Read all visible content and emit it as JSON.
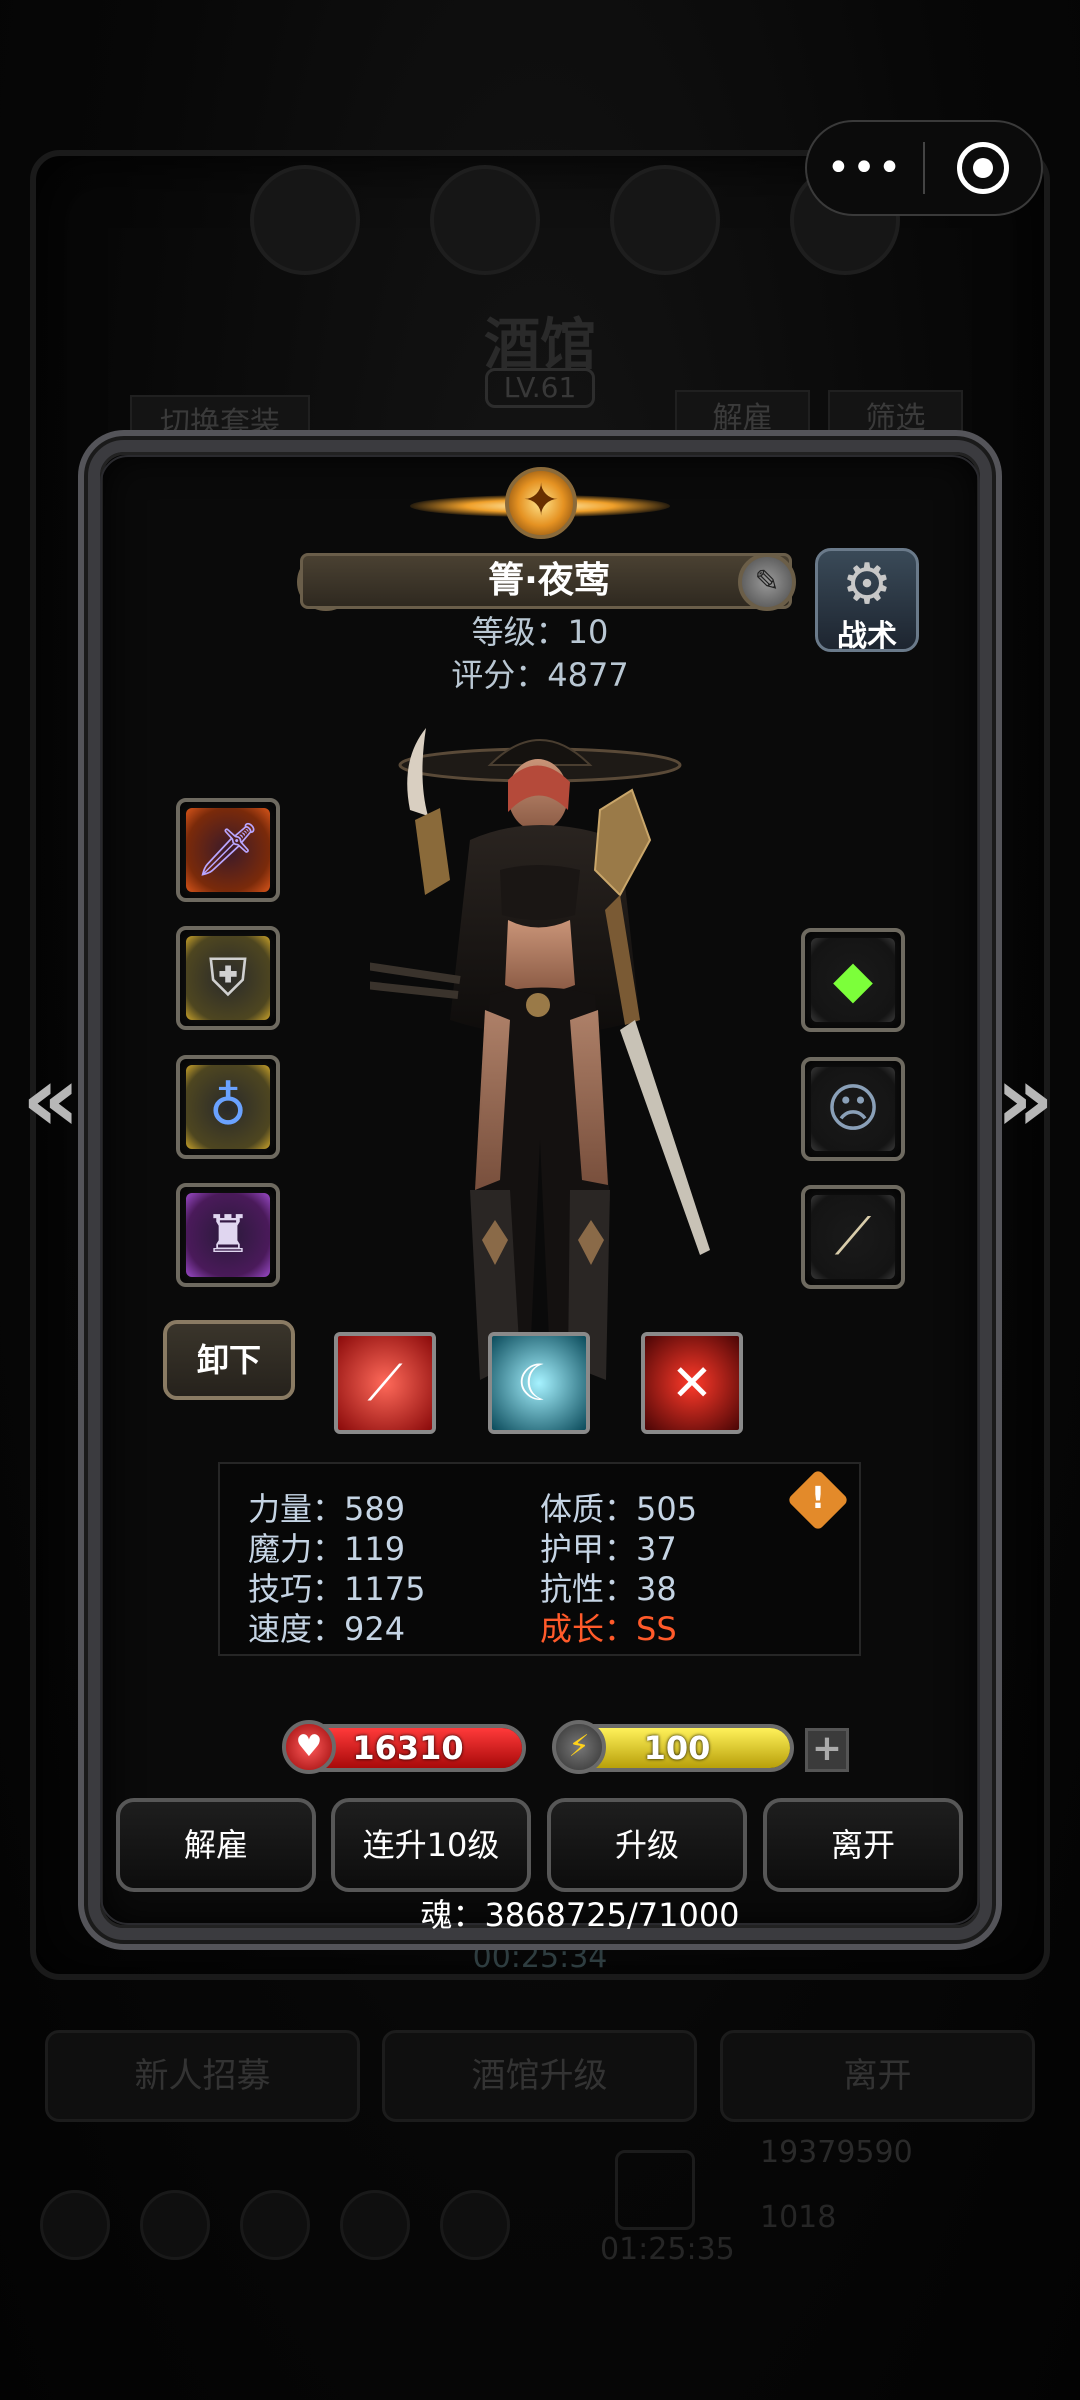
{
  "background": {
    "title": "酒馆",
    "level": "LV.61",
    "switch_outfit_label": "切换套装",
    "dismiss_label": "解雇",
    "filter_label": "筛选",
    "timer": "00:25:34",
    "recruit_label": "新人招募",
    "upgrade_tavern_label": "酒馆升级",
    "leave_label": "离开",
    "coins": "19379590",
    "timer2": "01:25:35",
    "gems": "1018"
  },
  "capsule": {
    "more_icon": "more-dots-icon",
    "close_icon": "target-close-icon"
  },
  "hero": {
    "name": "箐·夜莺",
    "level_text": "等级：10",
    "score_text": "评分：4877",
    "tactics_label": "战术",
    "unequip_label": "卸下"
  },
  "equipment_left": [
    {
      "icon": "dagger-icon",
      "rarity": "orange"
    },
    {
      "icon": "armor-icon",
      "rarity": "yellow"
    },
    {
      "icon": "amulet-icon",
      "rarity": "yellow"
    },
    {
      "icon": "helmet-icon",
      "rarity": "purple"
    }
  ],
  "equipment_right": [
    {
      "icon": "green-crystal-icon",
      "rarity": "grey"
    },
    {
      "icon": "mask-icon",
      "rarity": "grey"
    },
    {
      "icon": "bone-club-icon",
      "rarity": "grey"
    }
  ],
  "skills": [
    {
      "icon": "red-slash-skill-icon"
    },
    {
      "icon": "cyan-slash-skill-icon"
    },
    {
      "icon": "crimson-blade-skill-icon"
    }
  ],
  "stats": {
    "strength": "力量：589",
    "constitution": "体质：505",
    "magic": "魔力：119",
    "armor": "护甲：37",
    "skill": "技巧：1175",
    "resistance": "抗性：38",
    "speed": "速度：924",
    "growth": "成长：SS"
  },
  "bars": {
    "hp": "16310",
    "hp_fill": 1.0,
    "energy": "100",
    "energy_fill": 1.0,
    "plus": "+"
  },
  "actions": {
    "dismiss": "解雇",
    "level_up_10": "连升10级",
    "level_up": "升级",
    "leave": "离开"
  },
  "souls": "魂：3868725/71000",
  "colors": {
    "accent_gold": "#e59222",
    "growth_red": "#ff5a2a",
    "hp_red": "#d81a1a",
    "energy_yellow": "#e6d21a"
  }
}
